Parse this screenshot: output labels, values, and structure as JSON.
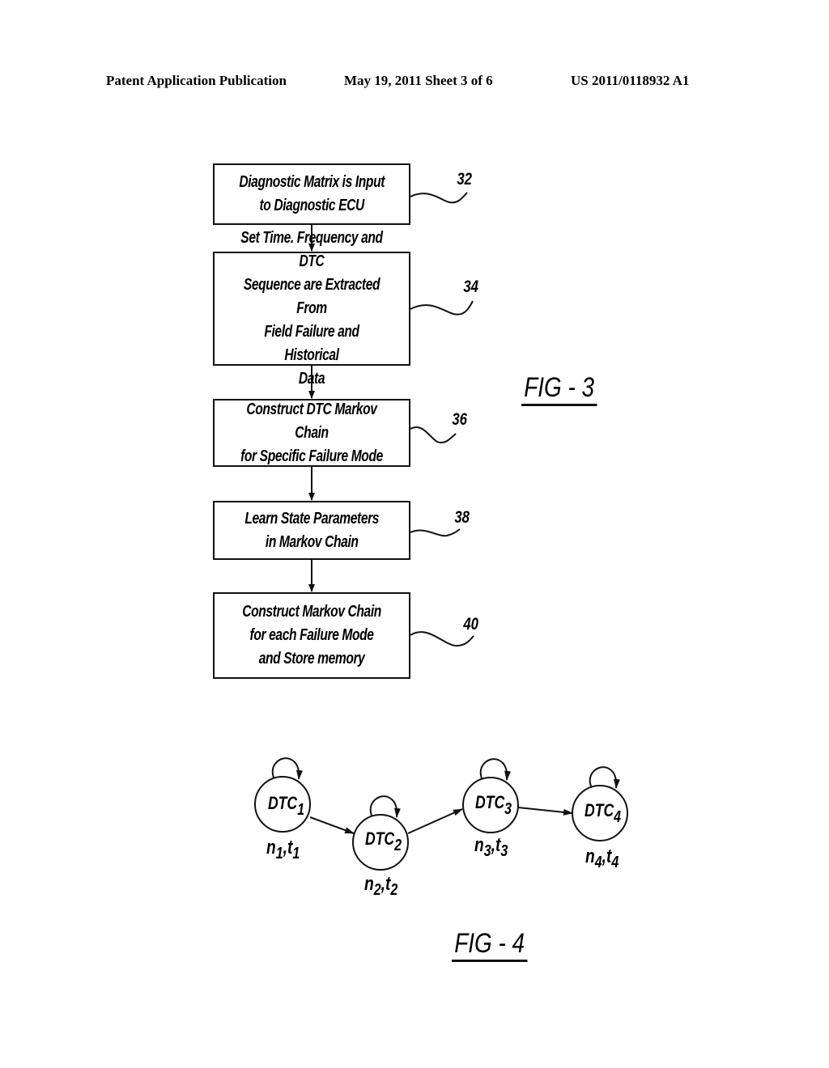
{
  "header": {
    "left": "Patent Application Publication",
    "middle": "May 19, 2011  Sheet 3 of 6",
    "right": "US 2011/0118932 A1"
  },
  "fig3": {
    "label": "FIG - 3",
    "steps": [
      {
        "ref": "32",
        "text": "Diagnostic Matrix is Input\nto Diagnostic ECU"
      },
      {
        "ref": "34",
        "text": "Set Time. Frequency and DTC\nSequence are Extracted From\nField Failure and Historical\nData"
      },
      {
        "ref": "36",
        "text": "Construct DTC Markov Chain\nfor Specific Failure Mode"
      },
      {
        "ref": "38",
        "text": "Learn State Parameters\nin Markov Chain"
      },
      {
        "ref": "40",
        "text": "Construct Markov Chain\nfor each Failure Mode\nand Store memory"
      }
    ]
  },
  "fig4": {
    "label": "FIG - 4",
    "nodes": [
      {
        "name": "DTC",
        "sub": "1",
        "n": "n",
        "n_sub": "1",
        "t": "t",
        "t_sub": "1"
      },
      {
        "name": "DTC",
        "sub": "2",
        "n": "n",
        "n_sub": "2",
        "t": "t",
        "t_sub": "2"
      },
      {
        "name": "DTC",
        "sub": "3",
        "n": "n",
        "n_sub": "3",
        "t": "t",
        "t_sub": "3"
      },
      {
        "name": "DTC",
        "sub": "4",
        "n": "n",
        "n_sub": "4",
        "t": "t",
        "t_sub": "4"
      }
    ]
  }
}
